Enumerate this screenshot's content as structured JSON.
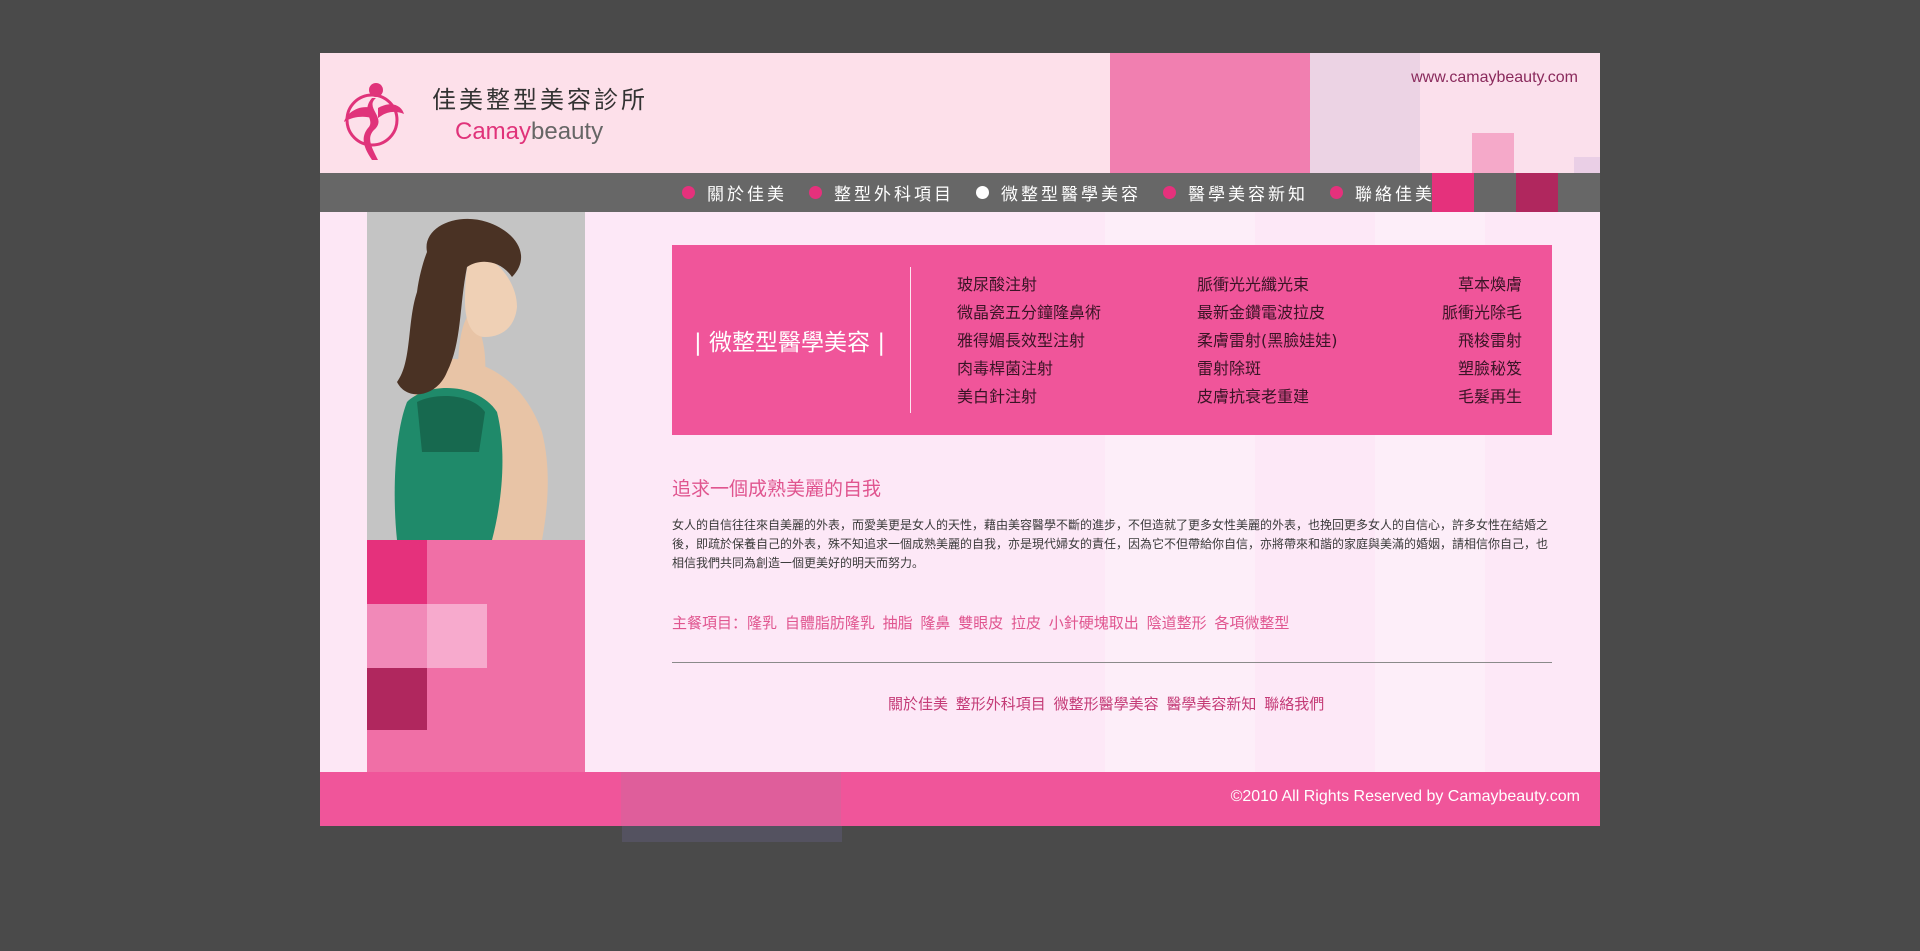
{
  "header": {
    "logo_cn": "佳美整型美容診所",
    "logo_en_1": "Camay",
    "logo_en_2": "beauty",
    "url": "www.camaybeauty.com"
  },
  "nav": {
    "items": [
      {
        "label": "關於佳美",
        "active": false
      },
      {
        "label": "整型外科項目",
        "active": false
      },
      {
        "label": "微整型醫學美容",
        "active": true
      },
      {
        "label": "醫學美容新知",
        "active": false
      },
      {
        "label": "聯絡佳美",
        "active": false
      }
    ]
  },
  "feature": {
    "title": "| 微整型醫學美容 |",
    "col1": [
      "玻尿酸注射",
      "微晶瓷五分鐘隆鼻術",
      "雅得媚長效型注射",
      "肉毒桿菌注射",
      "美白針注射"
    ],
    "col2": [
      "脈衝光光纖光束",
      "最新金鑽電波拉皮",
      "柔膚雷射(黑臉娃娃)",
      "雷射除斑",
      "皮膚抗衰老重建"
    ],
    "col3": [
      "草本煥膚",
      "脈衝光除毛",
      "飛梭雷射",
      "塑臉秘笈",
      "毛髮再生"
    ]
  },
  "content": {
    "headline": "追求一個成熟美麗的自我",
    "body": "女人的自信往往來自美麗的外表，而愛美更是女人的天性，藉由美容醫學不斷的進步，不但造就了更多女性美麗的外表，也挽回更多女人的自信心，許多女性在結婚之後，即疏於保養自己的外表，殊不知追求一個成熟美麗的自我，亦是現代婦女的責任，因為它不但帶給你自信，亦將帶來和諧的家庭與美滿的婚姻，請相信你自己，也相信我們共同為創造一個更美好的明天而努力。",
    "projects_label": "主餐項目：",
    "projects": [
      "隆乳",
      "自體脂肪隆乳",
      "抽脂",
      "隆鼻",
      "雙眼皮",
      "拉皮",
      "小針硬塊取出",
      "陰道整形",
      "各項微整型"
    ]
  },
  "footer_links": [
    "關於佳美",
    "整形外科項目",
    "微整形醫學美容",
    "醫學美容新知",
    "聯絡我們"
  ],
  "footer": {
    "copyright": "©2010 All Rights Reserved by Camaybeauty.com"
  },
  "colors": {
    "brand_pink": "#f0559a",
    "accent_magenta": "#e5317c",
    "nav_gray": "#676767",
    "background": "#4a4a4a"
  },
  "icons": {
    "logo": "fairy-logo-icon",
    "nav_bullet": "bullet-dot-icon"
  }
}
